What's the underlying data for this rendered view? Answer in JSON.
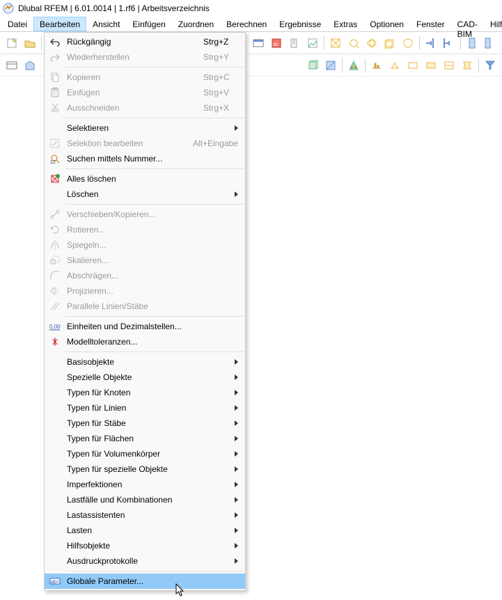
{
  "title": "Dlubal RFEM | 6.01.0014 | 1.rf6 | Arbeitsverzeichnis",
  "menubar": [
    "Datei",
    "Bearbeiten",
    "Ansicht",
    "Einfügen",
    "Zuordnen",
    "Berechnen",
    "Ergebnisse",
    "Extras",
    "Optionen",
    "Fenster",
    "CAD-BIM",
    "Hilfe"
  ],
  "menu": {
    "undo": {
      "label": "Rückgängig",
      "shortcut": "Strg+Z"
    },
    "redo": {
      "label": "Wiederherstellen",
      "shortcut": "Strg+Y"
    },
    "copy": {
      "label": "Kopieren",
      "shortcut": "Strg+C"
    },
    "paste": {
      "label": "Einfügen",
      "shortcut": "Strg+V"
    },
    "cut": {
      "label": "Ausschneiden",
      "shortcut": "Strg+X"
    },
    "select": {
      "label": "Selektieren"
    },
    "editsel": {
      "label": "Selektion bearbeiten",
      "shortcut": "Alt+Eingabe"
    },
    "findnum": {
      "label": "Suchen mittels Nummer..."
    },
    "delall": {
      "label": "Alles löschen"
    },
    "delete": {
      "label": "Löschen"
    },
    "move": {
      "label": "Verschieben/Kopieren..."
    },
    "rotate": {
      "label": "Rotieren..."
    },
    "mirror": {
      "label": "Spiegeln..."
    },
    "scale": {
      "label": "Skalieren..."
    },
    "bevel": {
      "label": "Abschrägen..."
    },
    "project": {
      "label": "Projizieren..."
    },
    "parallel": {
      "label": "Parallele Linien/Stäbe"
    },
    "units": {
      "label": "Einheiten und Dezimalstellen..."
    },
    "tolerances": {
      "label": "Modelltoleranzen..."
    },
    "basic": {
      "label": "Basisobjekte"
    },
    "special": {
      "label": "Spezielle Objekte"
    },
    "nodetypes": {
      "label": "Typen für Knoten"
    },
    "linetypes": {
      "label": "Typen für Linien"
    },
    "membertypes": {
      "label": "Typen für Stäbe"
    },
    "surftypes": {
      "label": "Typen für Flächen"
    },
    "solidtypes": {
      "label": "Typen für Volumenkörper"
    },
    "spectypes": {
      "label": "Typen für spezielle Objekte"
    },
    "imperfect": {
      "label": "Imperfektionen"
    },
    "loadcases": {
      "label": "Lastfälle und Kombinationen"
    },
    "loadassist": {
      "label": "Lastassistenten"
    },
    "loads": {
      "label": "Lasten"
    },
    "helpers": {
      "label": "Hilfsobjekte"
    },
    "printouts": {
      "label": "Ausdruckprotokolle"
    },
    "globalparam": {
      "label": "Globale Parameter..."
    }
  }
}
